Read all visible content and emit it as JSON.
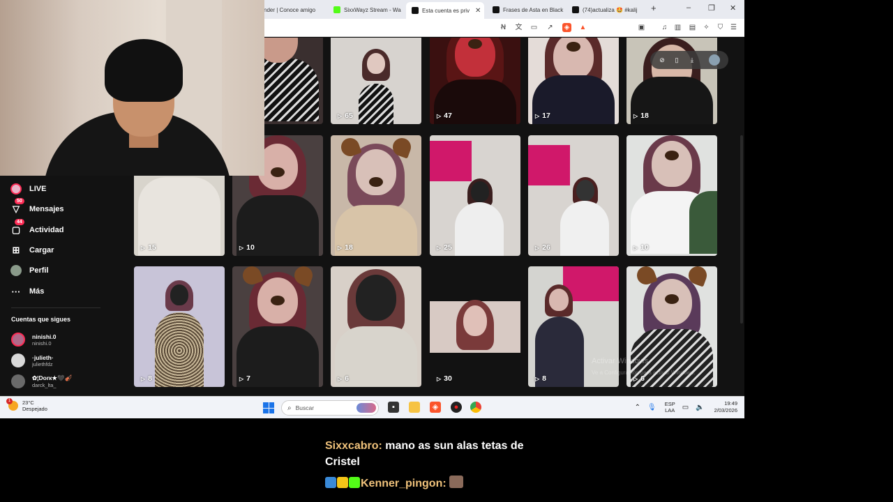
{
  "browser": {
    "tabs": [
      {
        "label": "nder | Conoce amigo",
        "icon": "tinder-icon",
        "active": false
      },
      {
        "label": "SixxWayz Stream - Wa",
        "icon": "kick-icon",
        "active": false
      },
      {
        "label": "Esta cuenta es priv",
        "icon": "tiktok-icon",
        "active": true
      },
      {
        "label": "Frases de Asta en Black",
        "icon": "tiktok-icon",
        "active": false
      },
      {
        "label": "(74)actualiza 🤩 #kalij",
        "icon": "tiktok-icon",
        "active": false
      }
    ],
    "new_tab": "+",
    "minimize": "–",
    "maximize": "❐",
    "close": "✕"
  },
  "sidebar": {
    "nav": [
      {
        "label": "LIVE",
        "icon": "live-icon",
        "badge": ""
      },
      {
        "label": "Mensajes",
        "icon": "messages-icon",
        "badge": "50"
      },
      {
        "label": "Actividad",
        "icon": "activity-icon",
        "badge": "44"
      },
      {
        "label": "Cargar",
        "icon": "upload-icon",
        "badge": ""
      },
      {
        "label": "Perfil",
        "icon": "profile-icon",
        "badge": ""
      },
      {
        "label": "Más",
        "icon": "more-icon",
        "badge": ""
      }
    ],
    "following_title": "Cuentas que sigues",
    "accounts": [
      {
        "display": "ninishi.0",
        "username": "ninishi.0"
      },
      {
        "display": "·julieth·",
        "username": "juliethfdz"
      },
      {
        "display": "✿¦Dorк★🖤🎻",
        "username": "darck_lta_"
      }
    ]
  },
  "grid": {
    "row1": [
      "",
      "65",
      "47",
      "17",
      "18"
    ],
    "row2": [
      "15",
      "10",
      "18",
      "25",
      "26",
      "10"
    ],
    "row3": [
      "8",
      "7",
      "6",
      "30",
      "8",
      "6"
    ]
  },
  "watermark": {
    "title": "Activar Windows",
    "subtitle": "Ve a Configuración para activar Windows."
  },
  "taskbar": {
    "weather_temp": "23°C",
    "weather_desc": "Despejado",
    "weather_badge": "1",
    "search_placeholder": "Buscar",
    "lang_top": "ESP",
    "lang_bottom": "LAA",
    "time": "19:49",
    "date": "2/03/2026"
  },
  "chat": {
    "line1_user": "Sixxcabro:",
    "line1_msg": " mano as sun alas tetas de Cristel",
    "line2_user": "Kenner_pingon:"
  },
  "colors": {
    "accent": "#fe2c55",
    "chat_user": "#f0c27b",
    "page_bg": "#121212"
  }
}
